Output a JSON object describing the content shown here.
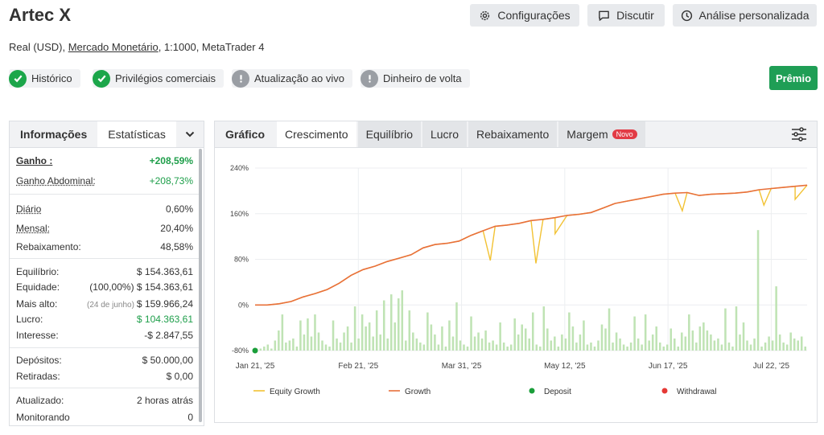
{
  "header": {
    "title": "Artec X",
    "subtitle_prefix": "Real (USD),",
    "subtitle_link": "Mercado Monetário",
    "subtitle_suffix": ", 1:1000, MetaTrader 4",
    "buttons": {
      "settings": "Configurações",
      "discuss": "Discutir",
      "analysis": "Análise personalizada"
    },
    "premio": "Prêmio"
  },
  "badges": [
    {
      "label": "Histórico",
      "status": "ok"
    },
    {
      "label": "Privilégios comerciais",
      "status": "ok"
    },
    {
      "label": "Atualização ao vivo",
      "status": "warn"
    },
    {
      "label": "Dinheiro de volta",
      "status": "warn"
    }
  ],
  "left_panel": {
    "tabs": [
      "Informações",
      "Estatísticas"
    ],
    "stats": {
      "gain_label": "Ganho :",
      "gain_value": "+208,59%",
      "abs_gain_label": "Ganho Abdominal:",
      "abs_gain_value": "+208,73%",
      "daily_label": "Diário",
      "daily_value": "0,60%",
      "monthly_label": "Mensal:",
      "monthly_value": "20,40%",
      "drawdown_label": "Rebaixamento:",
      "drawdown_value": "48,58%",
      "balance_label": "Equilíbrio:",
      "balance_value": "$ 154.363,61",
      "equity_label": "Equidade:",
      "equity_pct": "(100,00%)",
      "equity_value": "$ 154.363,61",
      "highest_label": "Mais alto:",
      "highest_date": "(24 de junho)",
      "highest_value": "$ 159.966,24",
      "profit_label": "Lucro:",
      "profit_value": "$ 104.363,61",
      "interest_label": "Interesse:",
      "interest_value": "-$ 2.847,55",
      "deposits_label": "Depósitos:",
      "deposits_value": "$ 50.000,00",
      "withdrawals_label": "Retiradas:",
      "withdrawals_value": "$ 0,00",
      "updated_label": "Atualizado:",
      "updated_value": "2 horas atrás",
      "monitoring_label": "Monitorando",
      "monitoring_value": "0"
    }
  },
  "right_panel": {
    "tabs": [
      "Gráfico",
      "Crescimento",
      "Equilíbrio",
      "Lucro",
      "Rebaixamento",
      "Margem"
    ],
    "new_badge": "Novo"
  },
  "colors": {
    "green": "#1ca64a",
    "growth": "#e8703a",
    "equity": "#f2c233",
    "bars": "#bfe3b4",
    "deposit": "#1a9e3a",
    "withdrawal": "#e53935"
  },
  "chart_data": {
    "type": "line",
    "y_ticks": [
      "240%",
      "160%",
      "80%",
      "0%",
      "-80%"
    ],
    "x_ticks": [
      "Jan 21, '25",
      "Feb 21, '25",
      "Mar 31, '25",
      "May 12, '25",
      "Jun 17, '25",
      "Jul 22, '25"
    ],
    "ylim": [
      -80,
      240
    ],
    "legend": [
      "Equity Growth",
      "Growth",
      "Deposit",
      "Withdrawal"
    ],
    "growth": [
      [
        0,
        0
      ],
      [
        5,
        0
      ],
      [
        10,
        2
      ],
      [
        15,
        6
      ],
      [
        20,
        14
      ],
      [
        25,
        20
      ],
      [
        30,
        27
      ],
      [
        35,
        38
      ],
      [
        40,
        52
      ],
      [
        45,
        62
      ],
      [
        50,
        68
      ],
      [
        55,
        76
      ],
      [
        60,
        82
      ],
      [
        65,
        88
      ],
      [
        70,
        100
      ],
      [
        75,
        106
      ],
      [
        80,
        108
      ],
      [
        85,
        112
      ],
      [
        90,
        122
      ],
      [
        95,
        130
      ],
      [
        100,
        138
      ],
      [
        105,
        140
      ],
      [
        110,
        143
      ],
      [
        115,
        148
      ],
      [
        120,
        150
      ],
      [
        125,
        153
      ],
      [
        130,
        157
      ],
      [
        135,
        159
      ],
      [
        140,
        162
      ],
      [
        145,
        170
      ],
      [
        150,
        178
      ],
      [
        155,
        182
      ],
      [
        160,
        186
      ],
      [
        165,
        190
      ],
      [
        170,
        194
      ],
      [
        175,
        196
      ],
      [
        180,
        197
      ],
      [
        185,
        192
      ],
      [
        190,
        194
      ],
      [
        195,
        195
      ],
      [
        200,
        196
      ],
      [
        205,
        198
      ],
      [
        210,
        202
      ],
      [
        215,
        204
      ],
      [
        220,
        206
      ],
      [
        225,
        208
      ],
      [
        230,
        210
      ]
    ],
    "equity_dips": [
      [
        98,
        78
      ],
      [
        117,
        73
      ],
      [
        125,
        125
      ],
      [
        178,
        165
      ],
      [
        212,
        175
      ],
      [
        225,
        185
      ]
    ],
    "deposit": [
      [
        0,
        -80
      ]
    ],
    "bars": [
      1,
      1,
      2,
      3,
      1,
      5,
      10,
      18,
      4,
      5,
      6,
      2,
      15,
      8,
      16,
      7,
      18,
      9,
      5,
      3,
      2,
      15,
      6,
      4,
      9,
      12,
      4,
      22,
      6,
      18,
      12,
      14,
      7,
      20,
      8,
      25,
      6,
      28,
      14,
      26,
      30,
      5,
      20,
      9,
      6,
      4,
      3,
      19,
      13,
      8,
      3,
      12,
      2,
      15,
      7,
      24,
      5,
      3,
      2,
      17,
      7,
      9,
      6,
      10,
      4,
      5,
      3,
      14,
      4,
      2,
      3,
      16,
      8,
      13,
      11,
      6,
      19,
      3,
      2,
      22,
      11,
      5,
      7,
      2,
      8,
      6,
      19,
      12,
      4,
      8,
      15,
      3,
      4,
      2,
      5,
      13,
      11,
      21,
      4,
      9,
      6,
      3,
      2,
      4,
      17,
      6,
      3,
      18,
      5,
      8,
      12,
      4,
      2,
      3,
      11,
      6,
      2,
      9,
      7,
      18,
      10,
      4,
      12,
      14,
      10,
      8,
      5,
      6,
      3,
      21,
      4,
      2,
      22,
      8,
      14,
      5,
      3,
      6,
      60,
      2,
      4,
      7,
      5,
      32,
      8,
      4,
      3,
      9,
      6,
      5,
      7,
      2
    ]
  }
}
